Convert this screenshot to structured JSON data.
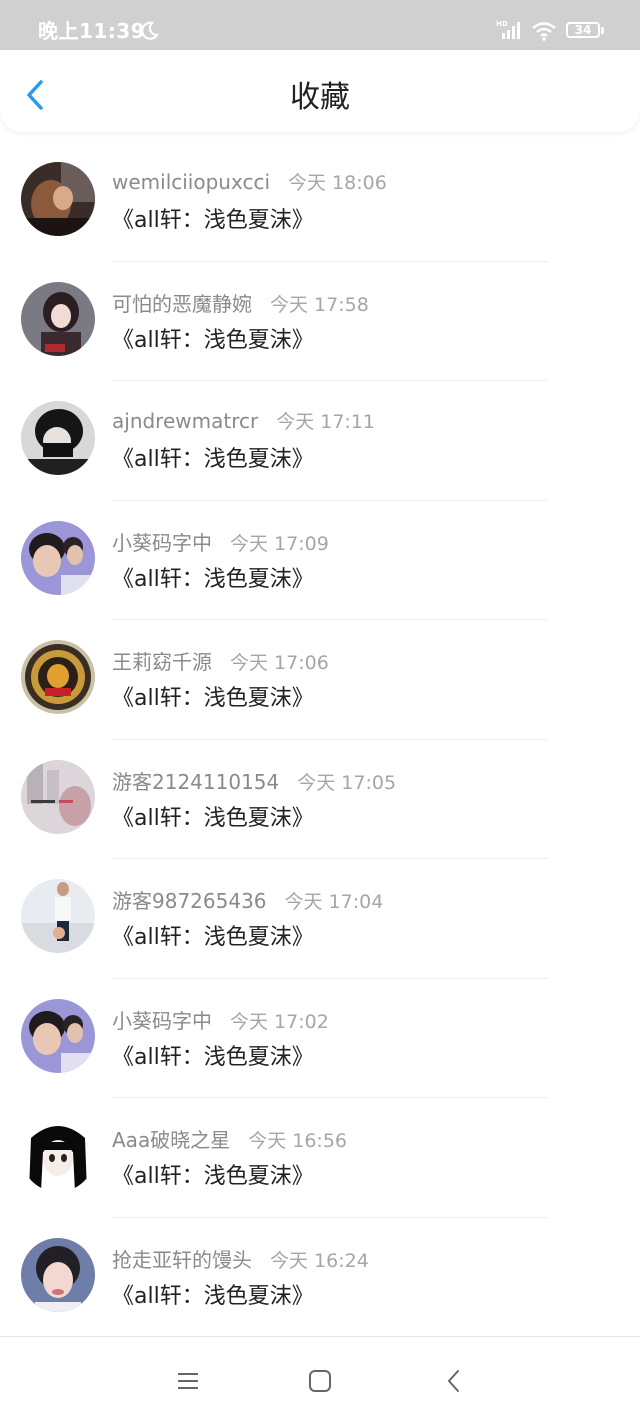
{
  "status": {
    "time": "晚上11:39",
    "battery": "34",
    "network_label": "HD",
    "icons": [
      "moon-icon",
      "signal-icon",
      "wifi-icon",
      "battery-icon"
    ]
  },
  "header": {
    "title": "收藏",
    "back_icon": "chevron-left-icon",
    "accent_color": "#2d9ae8"
  },
  "items": [
    {
      "user": "wemilciiopuxcci",
      "time": "今天 18:06",
      "title": "《all轩：浅色夏沫》"
    },
    {
      "user": "可怕的恶魔静婉",
      "time": "今天 17:58",
      "title": "《all轩：浅色夏沫》"
    },
    {
      "user": "ajndrewmatrcr",
      "time": "今天 17:11",
      "title": "《all轩：浅色夏沫》"
    },
    {
      "user": "小葵码字中",
      "time": "今天 17:09",
      "title": "《all轩：浅色夏沫》"
    },
    {
      "user": "王莉窈千源",
      "time": "今天 17:06",
      "title": "《all轩：浅色夏沫》"
    },
    {
      "user": "游客2124110154",
      "time": "今天 17:05",
      "title": "《all轩：浅色夏沫》"
    },
    {
      "user": "游客987265436",
      "time": "今天 17:04",
      "title": "《all轩：浅色夏沫》"
    },
    {
      "user": "小葵码字中",
      "time": "今天 17:02",
      "title": "《all轩：浅色夏沫》"
    },
    {
      "user": "Aaa破晓之星",
      "time": "今天 16:56",
      "title": "《all轩：浅色夏沫》"
    },
    {
      "user": "抢走亚轩的馒头",
      "time": "今天 16:24",
      "title": "《all轩：浅色夏沫》"
    }
  ],
  "system_nav": {
    "icons": [
      "menu-icon",
      "home-square-icon",
      "back-triangle-icon"
    ]
  }
}
